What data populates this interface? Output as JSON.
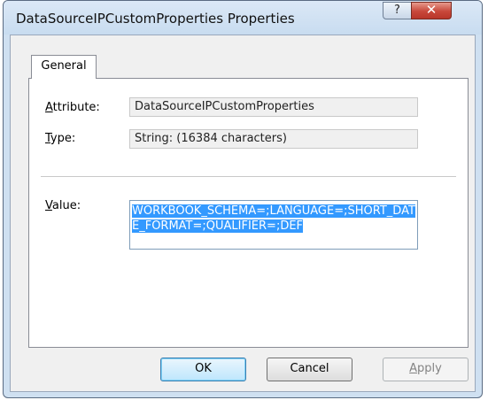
{
  "window": {
    "title": "DataSourceIPCustomProperties Properties",
    "help_glyph": "?",
    "close_glyph": "✕"
  },
  "tabs": [
    {
      "label": "General",
      "selected": true
    }
  ],
  "fields": {
    "attribute": {
      "label": "Attribute:",
      "mnemonic": "A",
      "rest": "ttribute:",
      "value": "DataSourceIPCustomProperties"
    },
    "type": {
      "label": "Type:",
      "mnemonic": "T",
      "rest": "ype:",
      "value": "String: (16384 characters)"
    },
    "value": {
      "label": "Value:",
      "mnemonic": "V",
      "rest": "alue:",
      "value": "WORKBOOK_SCHEMA=;LANGUAGE=;SHORT_DATE_FORMAT=;QUALIFIER=;DEF"
    }
  },
  "buttons": {
    "ok": "OK",
    "cancel": "Cancel",
    "apply": {
      "mnemonic": "A",
      "rest": "pply",
      "enabled": false
    }
  },
  "colors": {
    "selection": "#3399ff",
    "close_button": "#c8473a",
    "title_bar": "#cfe0f1"
  },
  "icons": {
    "help": "question-mark",
    "close": "x-mark"
  }
}
